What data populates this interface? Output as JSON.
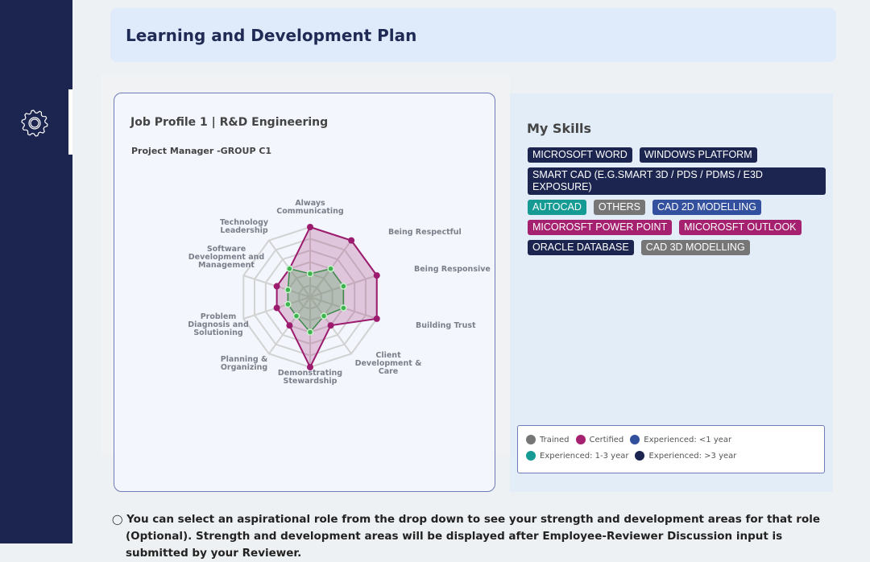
{
  "header": {
    "title": "Learning and Development Plan"
  },
  "sidebar": {
    "items": [
      {
        "icon": "gear-icon",
        "active": true
      }
    ]
  },
  "job_profile": {
    "title": "Job Profile 1 | R&D Engineering",
    "subtitle": "Project Manager -GROUP C1"
  },
  "chart_data": {
    "type": "radar",
    "categories": [
      "Always Communicating",
      "Being Respectful",
      "Being Responsive",
      "Building Trust",
      "Client Development & Care",
      "Demonstrating Stewardship",
      "Planning & Organizing",
      "Problem Diagnosis and Solutioning",
      "Software Development and Management",
      "Technology Leadership"
    ],
    "rlim": [
      0,
      6
    ],
    "grid": true,
    "series": [
      {
        "values": [
          6,
          6,
          6,
          6,
          3,
          6,
          3,
          3,
          3,
          3
        ],
        "color": "#9c1b6e"
      },
      {
        "values": [
          2,
          3,
          3,
          3,
          2,
          3,
          2,
          2,
          2,
          3
        ],
        "color": "#3d8b4a"
      }
    ]
  },
  "skills": {
    "title": "My Skills",
    "tags": [
      {
        "label": "MICROSOFT WORD",
        "color": "#1b2550"
      },
      {
        "label": "WINDOWS PLATFORM",
        "color": "#1b2550"
      },
      {
        "label": "SMART CAD (E.G.SMART 3D / PDS / PDMS / E3D EXPOSURE)",
        "color": "#1b2550"
      },
      {
        "label": "AUTOCAD",
        "color": "#159a94"
      },
      {
        "label": "OTHERS",
        "color": "#767676"
      },
      {
        "label": "CAD 2D MODELLING",
        "color": "#33509e"
      },
      {
        "label": "MICOROSFT POWER POINT",
        "color": "#a5206f"
      },
      {
        "label": "MICOROSFT OUTLOOK",
        "color": "#a5206f"
      },
      {
        "label": "ORACLE DATABASE",
        "color": "#1b2550"
      },
      {
        "label": "CAD 3D MODELLING",
        "color": "#767676"
      }
    ],
    "legend": [
      {
        "label": "Trained",
        "color": "#767676"
      },
      {
        "label": "Certified",
        "color": "#a5206f"
      },
      {
        "label": "Experienced: <1 year",
        "color": "#33509e"
      },
      {
        "label": "Experienced: 1-3 year",
        "color": "#159a94"
      },
      {
        "label": "Experienced: >3 year",
        "color": "#1b2550"
      }
    ]
  },
  "note": {
    "text": "You can select an aspirational role from the drop down to see your strength and development areas for that role (Optional). Strength and development areas will be displayed after Employee-Reviewer Discussion input is submitted by your Reviewer."
  }
}
